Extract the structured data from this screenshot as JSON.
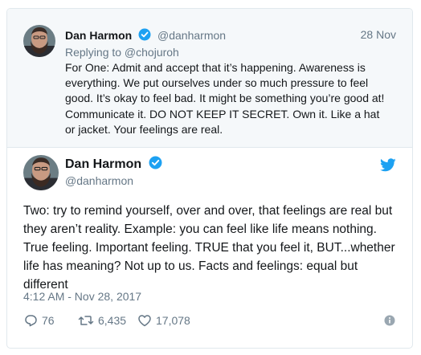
{
  "parent_tweet": {
    "author_name": "Dan Harmon",
    "author_handle": "@danharmon",
    "date": "28 Nov",
    "replying_to": "Replying to @chojuroh",
    "text": "For One: Admit and accept that it’s happening. Awareness is everything. We put ourselves under so much pressure to feel good. It’s okay to feel bad. It might be something you’re good at! Communicate it. DO NOT KEEP IT SECRET. Own it. Like a hat or jacket. Your feelings are real."
  },
  "tweet": {
    "author_name": "Dan Harmon",
    "author_handle": "@danharmon",
    "text": "Two: try to remind yourself, over and over, that feelings are real but they aren’t reality. Example: you can feel like life means nothing. True feeling. Important feeling. TRUE that you feel it, BUT...whether life has meaning? Not up to us. Facts and feelings: equal but different",
    "timestamp": "4:12 AM - Nov 28, 2017",
    "replies": "76",
    "retweets": "6,435",
    "likes": "17,078"
  },
  "colors": {
    "brand_blue": "#1da1f2",
    "secondary_text": "#657786",
    "border": "#e1e8ed",
    "parent_bg": "#f5f8fa"
  },
  "icons": [
    "verified-badge-icon",
    "twitter-bird-icon",
    "reply-icon",
    "retweet-icon",
    "like-icon",
    "info-icon"
  ]
}
